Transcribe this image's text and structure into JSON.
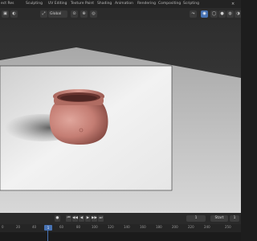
{
  "workspace_tabs": [
    "ect Res",
    "Sculpting",
    "UV Editing",
    "Texture Paint",
    "Shading",
    "Animation",
    "Rendering",
    "Compositing",
    "Scripting"
  ],
  "tab_close_glyph": "×",
  "viewport_header": {
    "editor_type_icon": "3d-viewport-icon",
    "transform_orientation": "Global",
    "shading_modes": [
      "wireframe",
      "solid",
      "material-preview",
      "rendered"
    ],
    "active_shading_mode": "material-preview"
  },
  "timeline": {
    "playback_controls": [
      "⏮",
      "◀◀",
      "◀",
      "▶",
      "▶▶",
      "⏭"
    ],
    "record_icon": "●",
    "current_frame": "1",
    "start_label": "Start",
    "end_label": "1",
    "ruler_ticks": [
      "0",
      "20",
      "40",
      "60",
      "80",
      "100",
      "120",
      "140",
      "160",
      "180",
      "200",
      "220",
      "240",
      "250"
    ],
    "playhead_frame": "1"
  },
  "viewport": {
    "render_region_background": "#e9e9e9",
    "floor_color": "#c9c9c9",
    "background_color": "#3b3b3b",
    "pot_color": "#c47d73"
  }
}
